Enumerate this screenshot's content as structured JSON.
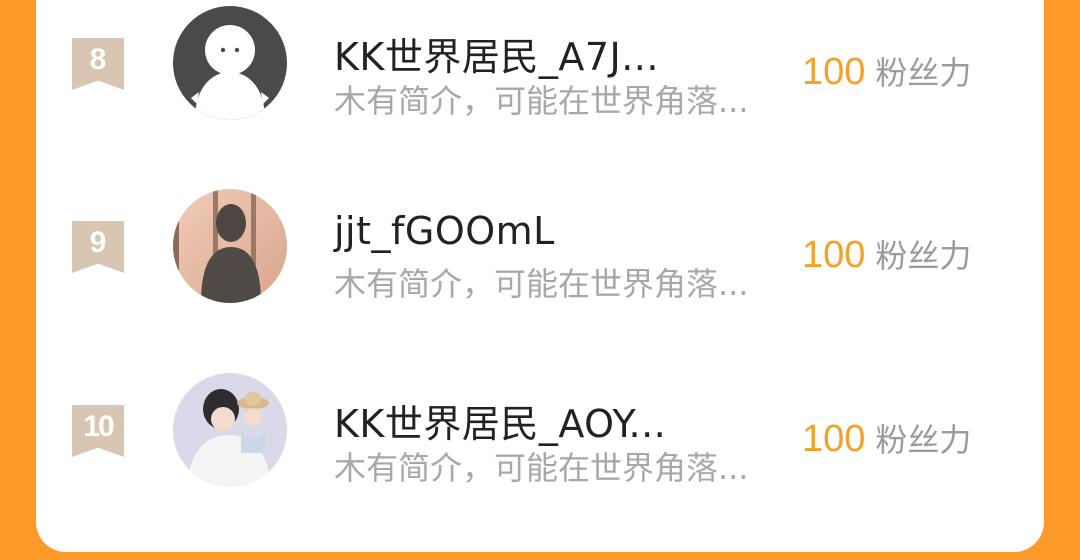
{
  "rows": [
    {
      "rank": "8",
      "name": "KK世界居民_A7J...",
      "bio": "木有简介，可能在世界角落...",
      "fans_count": "100",
      "fans_label": "粉丝力",
      "avatar_icon": "default-person-icon"
    },
    {
      "rank": "9",
      "name": "jjt_fGOOmL",
      "bio": "木有简介，可能在世界角落...",
      "fans_count": "100",
      "fans_label": "粉丝力",
      "avatar_icon": "silhouette-photo"
    },
    {
      "rank": "10",
      "name": "KK世界居民_AOY...",
      "bio": "木有简介，可能在世界角落...",
      "fans_count": "100",
      "fans_label": "粉丝力",
      "avatar_icon": "illustrated-person-photo"
    }
  ],
  "colors": {
    "background": "#fb9a28",
    "rank_badge": "#d9c6b2",
    "fans_number": "#f3a12a",
    "name_text": "#222222",
    "bio_text": "#a8a8a8"
  }
}
